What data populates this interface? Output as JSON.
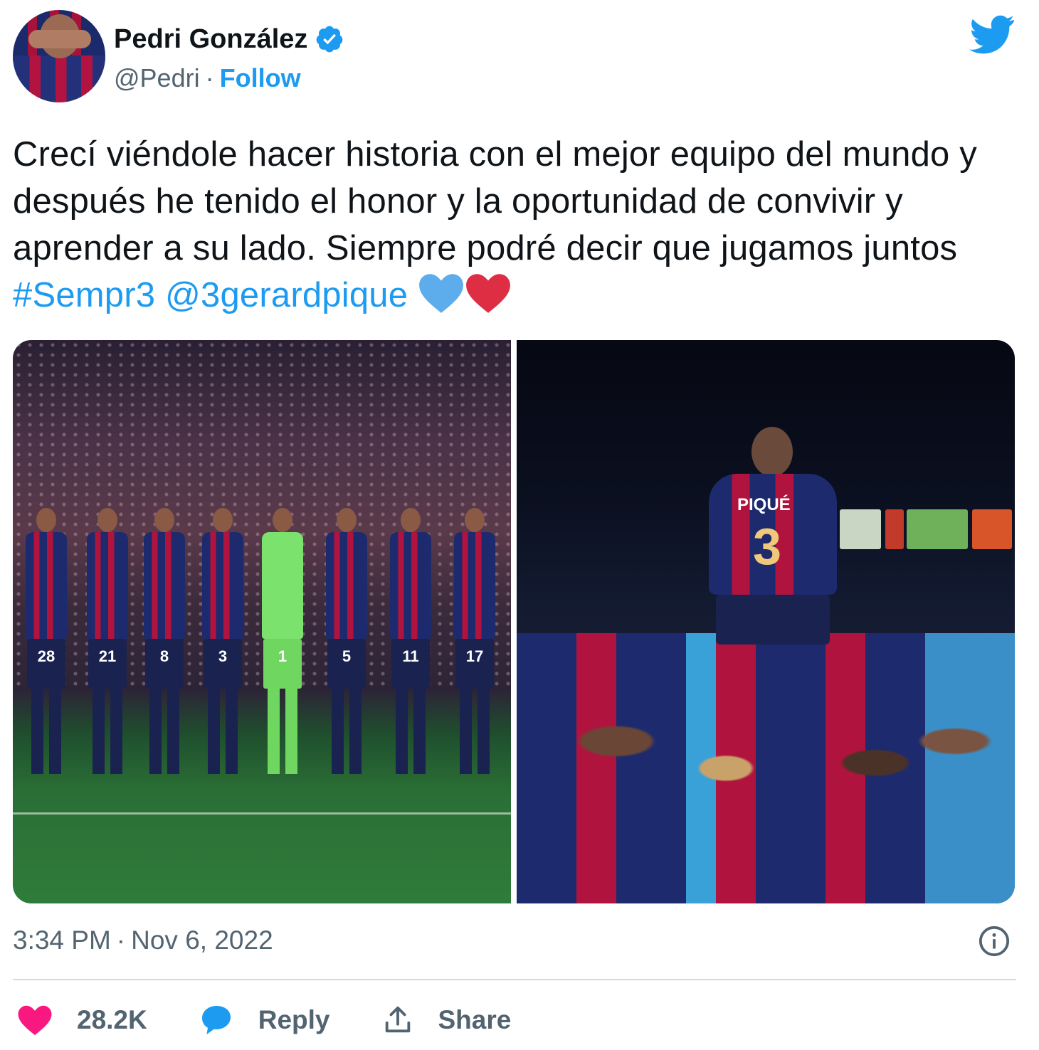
{
  "author": {
    "display_name": "Pedri González",
    "handle": "@Pedri",
    "separator": "·",
    "follow_label": "Follow",
    "verified": true
  },
  "tweet": {
    "text_main": "Crecí viéndole hacer historia con el mejor equipo del mundo y después he tenido el honor y la oportunidad de convivir y aprender a su lado. Siempre podré decir que jugamos juntos ",
    "hashtag": "#Sempr3",
    "mention": "@3gerardpique",
    "emojis": [
      "blue-heart",
      "red-heart"
    ]
  },
  "media": {
    "photos": [
      {
        "name": "team-lineup-photo",
        "jersey_numbers": [
          "28",
          "21",
          "8",
          "3",
          "1",
          "5",
          "11",
          "17"
        ]
      },
      {
        "name": "pique-lifted-photo",
        "jersey_name": "PIQUÉ",
        "jersey_number": "3"
      }
    ]
  },
  "meta": {
    "time": "3:34 PM",
    "separator": "·",
    "date": "Nov 6, 2022"
  },
  "actions": {
    "like_count": "28.2K",
    "reply_label": "Reply",
    "share_label": "Share"
  },
  "colors": {
    "accent": "#1d9bf0",
    "like": "#f91880",
    "text": "#0f1419",
    "secondary": "#536471",
    "divider": "#cfd9de"
  }
}
